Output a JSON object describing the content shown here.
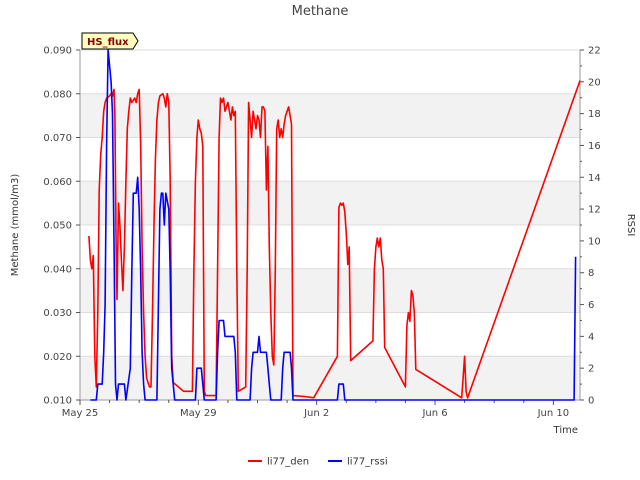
{
  "chart_data": {
    "type": "line",
    "title": "Methane",
    "xlabel": "Time",
    "ylabel": "Methane (mmol/m3)",
    "y2label": "RSSI",
    "badge": "HS_flux",
    "x_ticks": [
      {
        "day": 0,
        "label": "May 25"
      },
      {
        "day": 4,
        "label": "May 29"
      },
      {
        "day": 8,
        "label": "Jun 2"
      },
      {
        "day": 12,
        "label": "Jun 6"
      },
      {
        "day": 16,
        "label": "Jun 10"
      }
    ],
    "xlim": [
      0,
      16.9
    ],
    "ylim": [
      0.01,
      0.09
    ],
    "y_ticks": [
      "0.010",
      "0.020",
      "0.030",
      "0.040",
      "0.050",
      "0.060",
      "0.070",
      "0.080",
      "0.090"
    ],
    "y2lim": [
      0,
      22
    ],
    "y2_ticks": [
      "0",
      "2",
      "4",
      "6",
      "8",
      "10",
      "12",
      "14",
      "16",
      "18",
      "20",
      "22"
    ],
    "grid": true,
    "legend_position": "bottom",
    "series": [
      {
        "name": "li77_den",
        "color": "#ff0000",
        "axis": "left",
        "points": [
          [
            0.3,
            0.0475
          ],
          [
            0.35,
            0.042
          ],
          [
            0.4,
            0.04
          ],
          [
            0.45,
            0.043
          ],
          [
            0.5,
            0.02
          ],
          [
            0.55,
            0.013
          ],
          [
            0.6,
            0.03
          ],
          [
            0.65,
            0.058
          ],
          [
            0.7,
            0.066
          ],
          [
            0.75,
            0.07
          ],
          [
            0.8,
            0.076
          ],
          [
            0.85,
            0.078
          ],
          [
            0.9,
            0.079
          ],
          [
            1.0,
            0.0795
          ],
          [
            1.05,
            0.08
          ],
          [
            1.1,
            0.0795
          ],
          [
            1.15,
            0.081
          ],
          [
            1.18,
            0.075
          ],
          [
            1.22,
            0.046
          ],
          [
            1.25,
            0.033
          ],
          [
            1.3,
            0.055
          ],
          [
            1.35,
            0.05
          ],
          [
            1.4,
            0.042
          ],
          [
            1.45,
            0.035
          ],
          [
            1.5,
            0.045
          ],
          [
            1.55,
            0.06
          ],
          [
            1.6,
            0.072
          ],
          [
            1.65,
            0.076
          ],
          [
            1.7,
            0.079
          ],
          [
            1.75,
            0.078
          ],
          [
            1.8,
            0.0785
          ],
          [
            1.85,
            0.079
          ],
          [
            1.9,
            0.078
          ],
          [
            1.95,
            0.08
          ],
          [
            2.0,
            0.081
          ],
          [
            2.05,
            0.068
          ],
          [
            2.1,
            0.045
          ],
          [
            2.15,
            0.03
          ],
          [
            2.2,
            0.02
          ],
          [
            2.25,
            0.015
          ],
          [
            2.3,
            0.014
          ],
          [
            2.35,
            0.013
          ],
          [
            2.4,
            0.013
          ],
          [
            2.45,
            0.03
          ],
          [
            2.5,
            0.05
          ],
          [
            2.55,
            0.065
          ],
          [
            2.6,
            0.074
          ],
          [
            2.65,
            0.078
          ],
          [
            2.7,
            0.0795
          ],
          [
            2.8,
            0.08
          ],
          [
            2.85,
            0.079
          ],
          [
            2.9,
            0.077
          ],
          [
            2.95,
            0.08
          ],
          [
            3.0,
            0.078
          ],
          [
            3.05,
            0.06
          ],
          [
            3.1,
            0.02
          ],
          [
            3.15,
            0.014
          ],
          [
            3.5,
            0.012
          ],
          [
            3.8,
            0.012
          ],
          [
            3.85,
            0.04
          ],
          [
            3.9,
            0.06
          ],
          [
            3.95,
            0.07
          ],
          [
            4.0,
            0.074
          ],
          [
            4.05,
            0.072
          ],
          [
            4.1,
            0.071
          ],
          [
            4.15,
            0.068
          ],
          [
            4.2,
            0.012
          ],
          [
            4.25,
            0.011
          ],
          [
            4.6,
            0.011
          ],
          [
            4.65,
            0.04
          ],
          [
            4.7,
            0.07
          ],
          [
            4.75,
            0.079
          ],
          [
            4.8,
            0.078
          ],
          [
            4.85,
            0.079
          ],
          [
            4.9,
            0.076
          ],
          [
            5.0,
            0.078
          ],
          [
            5.05,
            0.076
          ],
          [
            5.1,
            0.074
          ],
          [
            5.15,
            0.077
          ],
          [
            5.2,
            0.075
          ],
          [
            5.25,
            0.076
          ],
          [
            5.3,
            0.04
          ],
          [
            5.35,
            0.012
          ],
          [
            5.6,
            0.013
          ],
          [
            5.65,
            0.04
          ],
          [
            5.7,
            0.078
          ],
          [
            5.75,
            0.074
          ],
          [
            5.8,
            0.07
          ],
          [
            5.85,
            0.076
          ],
          [
            5.9,
            0.074
          ],
          [
            5.95,
            0.072
          ],
          [
            6.0,
            0.075
          ],
          [
            6.05,
            0.074
          ],
          [
            6.1,
            0.07
          ],
          [
            6.15,
            0.077
          ],
          [
            6.2,
            0.077
          ],
          [
            6.25,
            0.076
          ],
          [
            6.3,
            0.058
          ],
          [
            6.35,
            0.068
          ],
          [
            6.4,
            0.045
          ],
          [
            6.45,
            0.03
          ],
          [
            6.5,
            0.02
          ],
          [
            6.55,
            0.018
          ],
          [
            6.6,
            0.04
          ],
          [
            6.65,
            0.072
          ],
          [
            6.7,
            0.074
          ],
          [
            6.75,
            0.07
          ],
          [
            6.8,
            0.072
          ],
          [
            6.85,
            0.07
          ],
          [
            6.9,
            0.073
          ],
          [
            6.95,
            0.075
          ],
          [
            7.0,
            0.076
          ],
          [
            7.05,
            0.077
          ],
          [
            7.1,
            0.075
          ],
          [
            7.15,
            0.073
          ],
          [
            7.2,
            0.011
          ],
          [
            7.6,
            0.0108
          ],
          [
            7.9,
            0.0105
          ],
          [
            8.7,
            0.02
          ],
          [
            8.75,
            0.054
          ],
          [
            8.8,
            0.055
          ],
          [
            8.85,
            0.0545
          ],
          [
            8.9,
            0.055
          ],
          [
            8.95,
            0.053
          ],
          [
            9.0,
            0.048
          ],
          [
            9.05,
            0.041
          ],
          [
            9.1,
            0.045
          ],
          [
            9.15,
            0.019
          ],
          [
            9.9,
            0.0235
          ],
          [
            9.95,
            0.04
          ],
          [
            10.0,
            0.045
          ],
          [
            10.05,
            0.047
          ],
          [
            10.1,
            0.045
          ],
          [
            10.15,
            0.047
          ],
          [
            10.2,
            0.042
          ],
          [
            10.25,
            0.04
          ],
          [
            10.3,
            0.022
          ],
          [
            11.0,
            0.013
          ],
          [
            11.05,
            0.027
          ],
          [
            11.1,
            0.03
          ],
          [
            11.15,
            0.028
          ],
          [
            11.2,
            0.035
          ],
          [
            11.25,
            0.034
          ],
          [
            11.3,
            0.03
          ],
          [
            11.35,
            0.017
          ],
          [
            12.9,
            0.0105
          ],
          [
            12.95,
            0.015
          ],
          [
            13.0,
            0.02
          ],
          [
            13.05,
            0.012
          ],
          [
            13.1,
            0.0105
          ],
          [
            16.9,
            0.083
          ]
        ]
      },
      {
        "name": "li77_rssi",
        "color": "#0000ff",
        "axis": "right",
        "points": [
          [
            0.35,
            0
          ],
          [
            0.55,
            0
          ],
          [
            0.6,
            1
          ],
          [
            0.7,
            1
          ],
          [
            0.75,
            1
          ],
          [
            0.8,
            3
          ],
          [
            0.85,
            6
          ],
          [
            0.9,
            16
          ],
          [
            0.95,
            22
          ],
          [
            1.0,
            21
          ],
          [
            1.05,
            20
          ],
          [
            1.1,
            18
          ],
          [
            1.15,
            10
          ],
          [
            1.2,
            1
          ],
          [
            1.25,
            0
          ],
          [
            1.3,
            1
          ],
          [
            1.5,
            1
          ],
          [
            1.55,
            0
          ],
          [
            1.7,
            2
          ],
          [
            1.75,
            8
          ],
          [
            1.8,
            13
          ],
          [
            1.9,
            13
          ],
          [
            1.95,
            14
          ],
          [
            2.0,
            12
          ],
          [
            2.05,
            8
          ],
          [
            2.1,
            3
          ],
          [
            2.15,
            1
          ],
          [
            2.2,
            0
          ],
          [
            2.6,
            0
          ],
          [
            2.65,
            6
          ],
          [
            2.7,
            12
          ],
          [
            2.75,
            13
          ],
          [
            2.8,
            13
          ],
          [
            2.85,
            11
          ],
          [
            2.9,
            13
          ],
          [
            3.0,
            12
          ],
          [
            3.05,
            8
          ],
          [
            3.1,
            2
          ],
          [
            3.2,
            0
          ],
          [
            3.9,
            0
          ],
          [
            3.95,
            2
          ],
          [
            4.0,
            2
          ],
          [
            4.1,
            2
          ],
          [
            4.15,
            1
          ],
          [
            4.2,
            0
          ],
          [
            4.6,
            0
          ],
          [
            4.65,
            3
          ],
          [
            4.7,
            5
          ],
          [
            4.85,
            5
          ],
          [
            4.9,
            4
          ],
          [
            5.2,
            4
          ],
          [
            5.25,
            3
          ],
          [
            5.3,
            0
          ],
          [
            5.75,
            0
          ],
          [
            5.8,
            2
          ],
          [
            5.85,
            3
          ],
          [
            5.9,
            3
          ],
          [
            6.0,
            3
          ],
          [
            6.05,
            4
          ],
          [
            6.1,
            3
          ],
          [
            6.3,
            3
          ],
          [
            6.35,
            2
          ],
          [
            6.4,
            1
          ],
          [
            6.45,
            0
          ],
          [
            6.8,
            0
          ],
          [
            6.85,
            2
          ],
          [
            6.9,
            3
          ],
          [
            7.0,
            3
          ],
          [
            7.05,
            3
          ],
          [
            7.1,
            3
          ],
          [
            7.15,
            2
          ],
          [
            7.2,
            0
          ],
          [
            8.7,
            0
          ],
          [
            8.75,
            1
          ],
          [
            8.9,
            1
          ],
          [
            8.95,
            0
          ],
          [
            16.7,
            0
          ],
          [
            16.75,
            9
          ]
        ]
      }
    ]
  }
}
